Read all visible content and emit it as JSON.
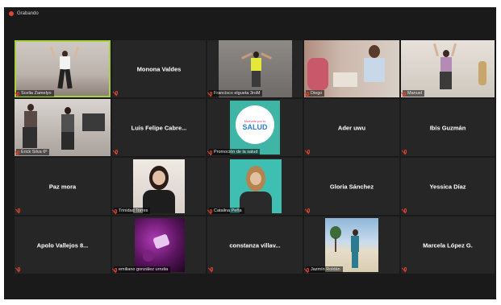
{
  "app": {
    "recording_label": "Grabando",
    "colors": {
      "recording": "#e0462f",
      "active_speaker": "#a7d23e",
      "tile_bg": "#262626",
      "window_bg": "#1a1a1a"
    }
  },
  "tiles": [
    {
      "id": "r1c1",
      "name": "Scelia Zamelyo",
      "video": true
    },
    {
      "id": "r1c2",
      "name": "Monona Valdes",
      "video": false
    },
    {
      "id": "r1c3",
      "name": "Francisco elgueta 3roM",
      "video": true
    },
    {
      "id": "r1c4",
      "name": "Diego",
      "video": true
    },
    {
      "id": "r1c5",
      "name": "Manuel",
      "video": true
    },
    {
      "id": "r2c1",
      "name": "Erick Silva 6º",
      "video": true
    },
    {
      "id": "r2c2",
      "name": "Luis Felipe Cabre...",
      "video": false
    },
    {
      "id": "r2c3",
      "name": "Promoción de la salud",
      "video": true,
      "poster": {
        "line1": "Muévete por tu",
        "line2": "SALUD"
      }
    },
    {
      "id": "r2c4",
      "name": "Ader uwu",
      "video": false
    },
    {
      "id": "r2c5",
      "name": "Ibis Guzmán",
      "video": false
    },
    {
      "id": "r3c1",
      "name": "Paz mora",
      "video": false
    },
    {
      "id": "r3c2",
      "name": "Trinidad Torres",
      "video": true
    },
    {
      "id": "r3c3",
      "name": "Catalina Peña",
      "video": true
    },
    {
      "id": "r3c4",
      "name": "Gloria Sánchez",
      "video": false
    },
    {
      "id": "r3c5",
      "name": "Yessica Díaz",
      "video": false
    },
    {
      "id": "r4c1",
      "name": "Apolo Vallejos 8...",
      "video": false
    },
    {
      "id": "r4c2",
      "name": "emiliano gonzález urrutia",
      "video": true
    },
    {
      "id": "r4c3",
      "name": "constanza villav...",
      "video": false
    },
    {
      "id": "r4c4",
      "name": "Jazmín Roldán",
      "video": true
    },
    {
      "id": "r4c5",
      "name": "Marcela López G.",
      "video": false
    }
  ]
}
